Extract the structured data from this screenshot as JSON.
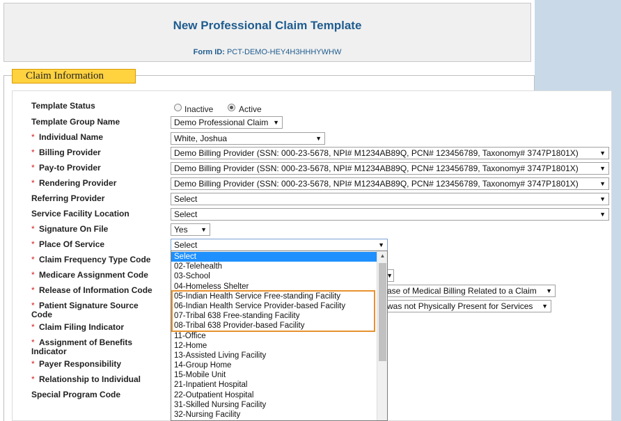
{
  "header": {
    "title": "New Professional Claim Template",
    "form_id_label": "Form ID:",
    "form_id_value": "PCT-DEMO-HEY4H3HHHYWHW"
  },
  "section": {
    "legend": "Claim Information"
  },
  "required_marker": "*",
  "labels": {
    "template_status": "Template Status",
    "template_group_name": "Template Group Name",
    "individual_name": "Individual Name",
    "billing_provider": "Billing Provider",
    "pay_to_provider": "Pay-to Provider",
    "rendering_provider": "Rendering Provider",
    "referring_provider": "Referring Provider",
    "service_facility_location": "Service Facility Location",
    "signature_on_file": "Signature On File",
    "place_of_service": "Place Of Service",
    "claim_frequency_type_code": "Claim Frequency Type Code",
    "medicare_assignment_code": "Medicare Assignment Code",
    "release_of_information_code": "Release of Information Code",
    "patient_signature_source_code_1": "Patient Signature Source",
    "patient_signature_source_code_2": "Code",
    "claim_filing_indicator": "Claim Filing Indicator",
    "assignment_of_benefits_1": "Assignment of Benefits",
    "assignment_of_benefits_2": "Indicator",
    "payer_responsibility": "Payer Responsibility",
    "relationship_to_individual": "Relationship to Individual",
    "special_program_code": "Special Program Code"
  },
  "status": {
    "inactive": "Inactive",
    "active": "Active",
    "selected": "Active"
  },
  "values": {
    "template_group_name": "Demo Professional Claim",
    "individual_name": "White, Joshua",
    "billing_provider": "Demo Billing Provider (SSN: 000-23-5678, NPI# M1234AB89Q, PCN# 123456789, Taxonomy# 3747P1801X)",
    "pay_to_provider": "Demo Billing Provider (SSN: 000-23-5678, NPI# M1234AB89Q, PCN# 123456789, Taxonomy# 3747P1801X)",
    "rendering_provider": "Demo Billing Provider (SSN: 000-23-5678, NPI# M1234AB89Q, PCN# 123456789, Taxonomy# 3747P1801X)",
    "referring_provider": "Select",
    "service_facility_location": "Select",
    "signature_on_file": "Yes",
    "place_of_service": "Select",
    "release_of_information_partial": "ase of Medical Billing Related to a Claim",
    "patient_signature_partial": "was not Physically Present for Services"
  },
  "dropdown": {
    "options": [
      "Select",
      "02-Telehealth",
      "03-School",
      "04-Homeless Shelter",
      "05-Indian Health Service Free-standing Facility",
      "06-Indian Health Service Provider-based Facility",
      "07-Tribal 638 Free-standing Facility",
      "08-Tribal 638 Provider-based Facility",
      "11-Office",
      "12-Home",
      "13-Assisted Living Facility",
      "14-Group Home",
      "15-Mobile Unit",
      "21-Inpatient Hospital",
      "22-Outpatient Hospital",
      "31-Skilled Nursing Facility",
      "32-Nursing Facility"
    ],
    "highlighted": "Select"
  },
  "colors": {
    "title": "#1f5c8f",
    "legend_bg": "#ffd240",
    "highlight": "#1e90ff",
    "annotation": "#e8912f",
    "required": "#d32020"
  },
  "icons": {
    "dropdown_arrow": "chevron-down-icon",
    "scroll_up": "scroll-up-arrow-icon"
  }
}
